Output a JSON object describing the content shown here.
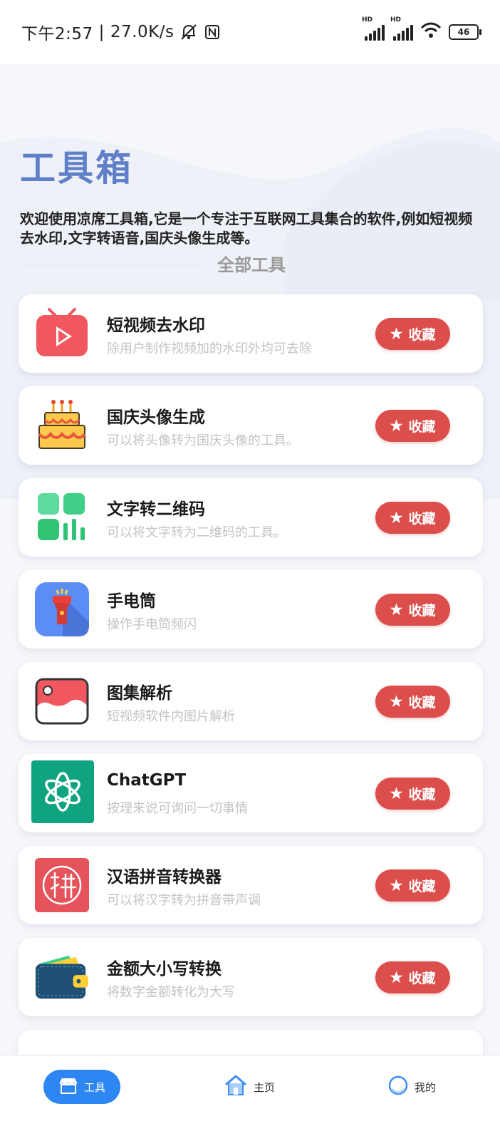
{
  "status_bar": {
    "time": "下午2:57",
    "separator": "|",
    "speed": "27.0K/s",
    "network_label": "HD",
    "battery": "46"
  },
  "header": {
    "title": "工具箱",
    "welcome": "欢迎使用凉席工具箱,它是一个专注于互联网工具集合的软件,例如短视频去水印,文字转语音,国庆头像生成等。"
  },
  "section": {
    "label": "全部工具"
  },
  "fav_label": "收藏",
  "tools": [
    {
      "name": "短视频去水印",
      "desc": "除用户制作视频加的水印外均可去除",
      "icon": "video-play-icon"
    },
    {
      "name": "国庆头像生成",
      "desc": "可以将头像转为国庆头像的工具。",
      "icon": "birthday-cake-icon"
    },
    {
      "name": "文字转二维码",
      "desc": "可以将文字转为二维码的工具。",
      "icon": "qr-grid-icon"
    },
    {
      "name": "手电筒",
      "desc": "操作手电筒频闪",
      "icon": "flashlight-icon"
    },
    {
      "name": "图集解析",
      "desc": "短视频软件内图片解析",
      "icon": "photo-album-icon"
    },
    {
      "name": "ChatGPT",
      "desc": "按理来说可询问一切事情",
      "icon": "chatgpt-logo-icon"
    },
    {
      "name": "汉语拼音转换器",
      "desc": "可以将汉字转为拼音带声调",
      "icon": "pinyin-icon"
    },
    {
      "name": "金额大小写转换",
      "desc": "将数字金额转化为大写",
      "icon": "wallet-icon"
    }
  ],
  "tabbar": {
    "tools": "工具",
    "home": "主页",
    "mine": "我的"
  },
  "colors": {
    "accent_blue": "#2d86f1",
    "title_blue": "#5f80c8",
    "fav_red": "#dc4e4c"
  }
}
